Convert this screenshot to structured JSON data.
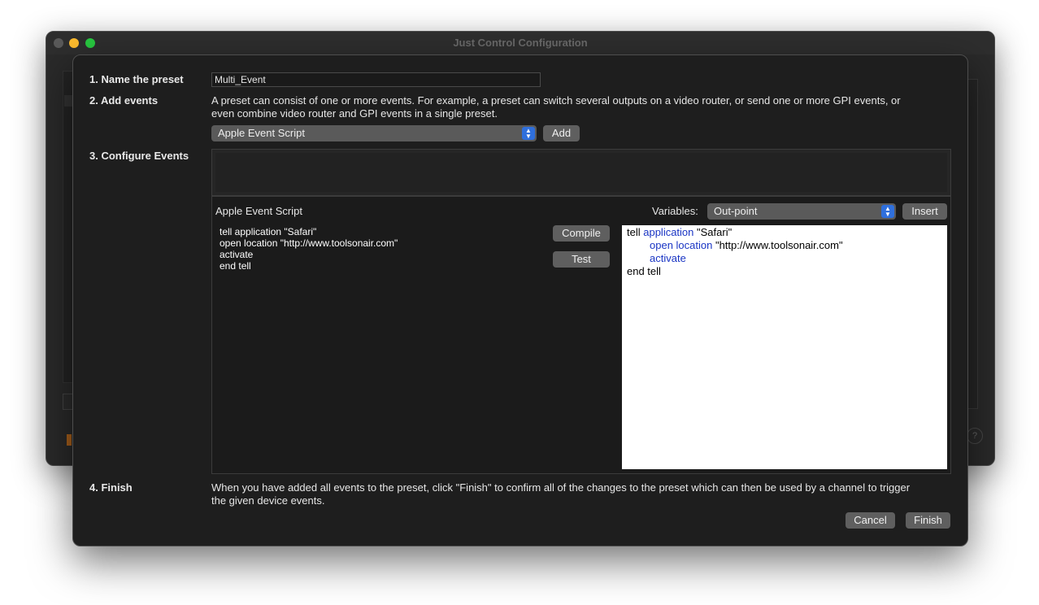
{
  "window": {
    "title": "Just Control Configuration"
  },
  "sheet": {
    "step1": {
      "label": "1. Name the preset",
      "preset_name": "Multi_Event"
    },
    "step2": {
      "label": "2. Add events",
      "description_line1": "A preset can consist of one or more events. For example, a preset can switch several outputs on a video router, or send one or more GPI events, or",
      "description_line2": "even combine video router and GPI events in a single preset.",
      "event_type_selected": "Apple Event Script",
      "add_button": "Add"
    },
    "step3": {
      "label": "3. Configure Events",
      "panel_title": "Apple Event Script",
      "variables_label": "Variables:",
      "variables_selected": "Out-point",
      "insert_button": "Insert",
      "compile_button": "Compile",
      "test_button": "Test",
      "source_lines": [
        "tell application \"Safari\"",
        "open location \"http://www.toolsonair.com\"",
        "activate",
        "end tell"
      ],
      "compiled": {
        "line1_plain_a": "tell ",
        "line1_kw": "application",
        "line1_plain_b": " \"Safari\"",
        "line2_kw": "open location",
        "line2_plain": " \"http://www.toolsonair.com\"",
        "line3_kw": "activate",
        "line4_plain": "end tell"
      }
    },
    "step4": {
      "label": "4. Finish",
      "description_line1": "When you have added all events to the preset, click \"Finish\" to confirm all of the changes to the preset which can then be used by a channel to trigger",
      "description_line2": "the given device events.",
      "cancel_button": "Cancel",
      "finish_button": "Finish"
    }
  },
  "icons": {
    "popup_arrows": "chevron-up-down-icon",
    "help": "help-icon",
    "help_glyph": "?"
  },
  "colors": {
    "keyword": "#1a35c4",
    "popup_accent": "#2f6fdc",
    "traffic_close": "#5a5a5a",
    "traffic_minimize": "#febc2e",
    "traffic_zoom": "#28c840"
  }
}
